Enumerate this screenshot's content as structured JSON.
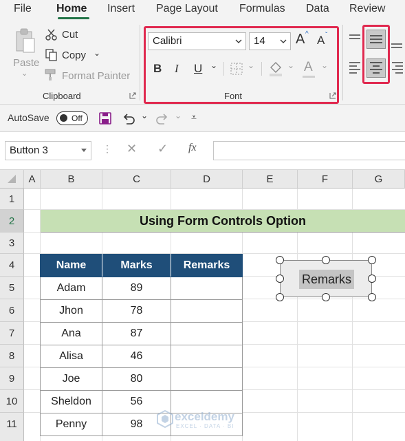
{
  "menu": {
    "items": [
      "File",
      "Home",
      "Insert",
      "Page Layout",
      "Formulas",
      "Data",
      "Review"
    ],
    "active": "Home"
  },
  "clipboard": {
    "paste": "Paste",
    "cut": "Cut",
    "copy": "Copy",
    "format_painter": "Format Painter",
    "group_label": "Clipboard"
  },
  "font": {
    "family": "Calibri",
    "size": "14",
    "bold": "B",
    "italic": "I",
    "underline": "U",
    "grow": "A",
    "shrink": "A",
    "color_letter": "A",
    "group_label": "Font"
  },
  "qat": {
    "autosave": "AutoSave",
    "toggle": "Off"
  },
  "formula_bar": {
    "name_box": "Button 3",
    "fx": "fx",
    "content": ""
  },
  "grid": {
    "columns": [
      "A",
      "B",
      "C",
      "D",
      "E",
      "F",
      "G"
    ],
    "rows": [
      "1",
      "2",
      "3",
      "4",
      "5",
      "6",
      "7",
      "8",
      "9",
      "10",
      "11"
    ]
  },
  "sheet": {
    "title": "Using Form Controls Option",
    "headers": [
      "Name",
      "Marks",
      "Remarks"
    ],
    "rows": [
      {
        "name": "Adam",
        "marks": "89",
        "remarks": ""
      },
      {
        "name": "Jhon",
        "marks": "78",
        "remarks": ""
      },
      {
        "name": "Ana",
        "marks": "87",
        "remarks": ""
      },
      {
        "name": "Alisa",
        "marks": "46",
        "remarks": ""
      },
      {
        "name": "Joe",
        "marks": "80",
        "remarks": ""
      },
      {
        "name": "Sheldon",
        "marks": "56",
        "remarks": ""
      },
      {
        "name": "Penny",
        "marks": "98",
        "remarks": ""
      }
    ]
  },
  "form_button": {
    "label": "Remarks"
  },
  "watermark": {
    "name": "exceldemy",
    "tagline": "EXCEL · DATA · BI"
  },
  "colors": {
    "accent": "#217346",
    "highlight": "#e0294f",
    "table_header": "#1f4e79",
    "title_fill": "#c6e0b4"
  }
}
